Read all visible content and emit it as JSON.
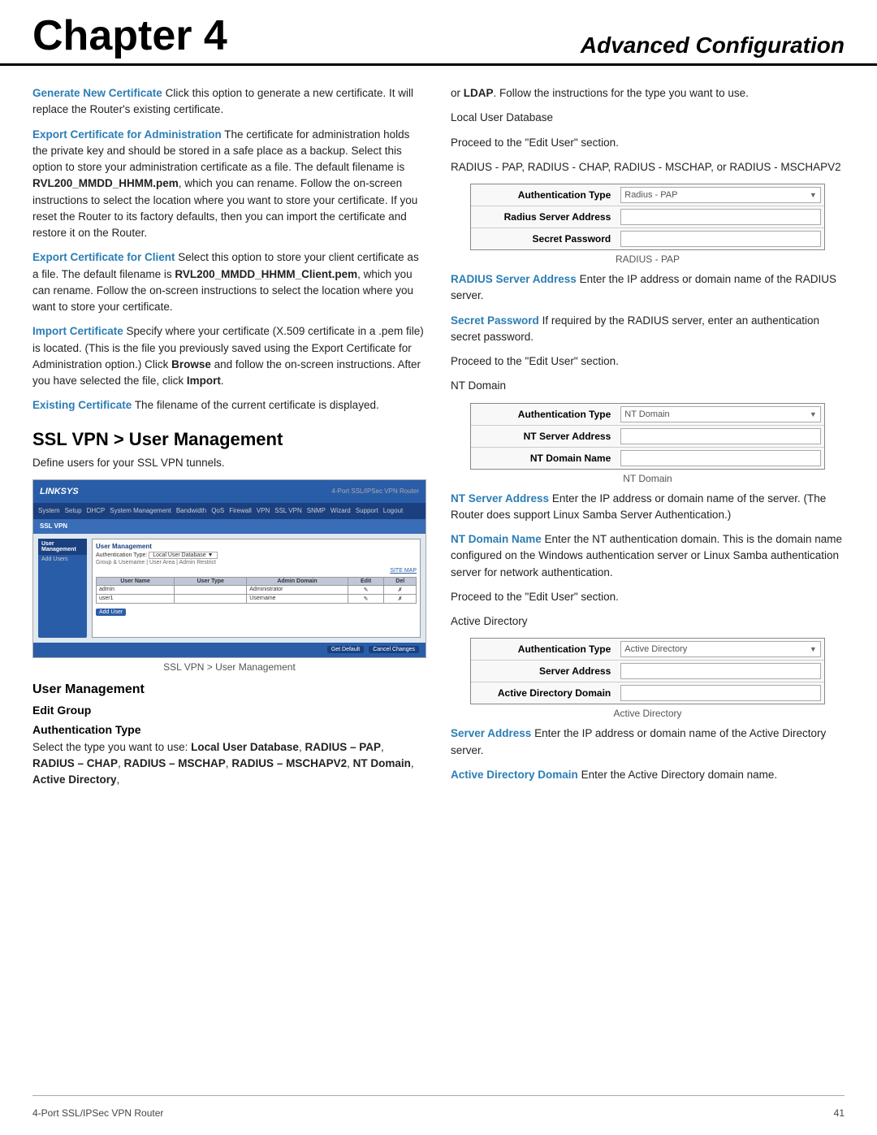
{
  "header": {
    "chapter": "Chapter 4",
    "title": "Advanced Configuration"
  },
  "footer": {
    "left": "4-Port SSL/IPSec VPN Router",
    "right": "41"
  },
  "left_col": {
    "paragraphs": [
      {
        "id": "generate-cert",
        "label": "Generate New Certificate",
        "text": " Click this option to generate a new certificate. It will replace the Router's existing certificate."
      },
      {
        "id": "export-cert-admin",
        "label": "Export Certificate for Administration",
        "text": " The certificate for administration holds the private key and should be stored in a safe place as a backup. Select this option to store your administration certificate as a file. The default filename is ",
        "bold_inline": "RVL200_MMDD_HHMM.pem",
        "text2": ", which you can rename. Follow the on-screen instructions to select the location where you want to store your certificate. If you reset the Router to its factory defaults, then you can import the certificate and restore it on the Router."
      },
      {
        "id": "export-cert-client",
        "label": "Export Certificate for Client",
        "text": " Select this option to store your client certificate as a file. The default filename is ",
        "bold_inline": "RVL200_MMDD_HHMM_Client.pem",
        "text2": ", which you can rename. Follow the on-screen instructions to select the location where you want to store your certificate."
      },
      {
        "id": "import-cert",
        "label": "Import Certificate",
        "text": " Specify where your certificate (X.509 certificate in a .pem file) is located. (This is the file you previously saved using the Export Certificate for Administration option.) Click ",
        "bold_inline2": "Browse",
        "text2": " and follow the on-screen instructions. After you have selected the file, click ",
        "bold_inline3": "Import",
        "text3": "."
      },
      {
        "id": "existing-cert",
        "label": "Existing Certificate",
        "text": " The filename of the current certificate is displayed."
      }
    ],
    "ssl_section": {
      "heading": "SSL VPN > User Management",
      "intro": "Define users for your SSL VPN tunnels.",
      "screenshot_caption": "SSL VPN > User Management"
    },
    "user_mgmt": {
      "heading": "User Management",
      "edit_group": "Edit Group",
      "auth_type_heading": "Authentication Type",
      "auth_type_text": "Select the type you want to use: ",
      "auth_type_options": "Local User Database, RADIUS – PAP, RADIUS – CHAP, RADIUS – MSCHAP, RADIUS – MSCHAPV2, NT Domain, Active Directory,"
    }
  },
  "right_col": {
    "ldap_text": "or ",
    "ldap_bold": "LDAP",
    "ldap_rest": ". Follow the instructions for the type you want to use.",
    "local_user_db": "Local User Database",
    "proceed_edit_user": "Proceed to the \"Edit User\" section.",
    "radius_options": "RADIUS - PAP, RADIUS - CHAP, RADIUS - MSCHAP, or RADIUS - MSCHAPV2",
    "radius_box": {
      "caption": "RADIUS - PAP",
      "rows": [
        {
          "label": "Authentication Type",
          "value": "Radius - PAP",
          "type": "select"
        },
        {
          "label": "Radius Server Address",
          "value": "",
          "type": "input"
        },
        {
          "label": "Secret Password",
          "value": "",
          "type": "input"
        }
      ]
    },
    "radius_server_address": {
      "label": "RADIUS Server Address",
      "text": " Enter the IP address or domain name of the RADIUS server."
    },
    "secret_password": {
      "label": "Secret Password",
      "text": " If required by the RADIUS server, enter an authentication secret password."
    },
    "proceed_edit_user2": "Proceed to the \"Edit User\" section.",
    "nt_domain_label": "NT Domain",
    "nt_domain_box": {
      "caption": "NT Domain",
      "rows": [
        {
          "label": "Authentication Type",
          "value": "NT Domain",
          "type": "select"
        },
        {
          "label": "NT Server Address",
          "value": "",
          "type": "input"
        },
        {
          "label": "NT Domain Name",
          "value": "",
          "type": "input"
        }
      ]
    },
    "nt_server_address": {
      "label": "NT Server Address",
      "text": " Enter the IP address or domain name of the server. (The Router does support Linux Samba Server Authentication.)"
    },
    "nt_domain_name": {
      "label": "NT Domain Name",
      "text": " Enter the NT authentication domain. This is the domain name configured on the Windows authentication server or Linux Samba authentication server for network authentication."
    },
    "proceed_edit_user3": "Proceed to the \"Edit User\" section.",
    "active_directory_label": "Active Directory",
    "active_directory_box": {
      "caption": "Active Directory",
      "rows": [
        {
          "label": "Authentication Type",
          "value": "Active Directory",
          "type": "select"
        },
        {
          "label": "Server Address",
          "value": "",
          "type": "input"
        },
        {
          "label": "Active Directory Domain",
          "value": "",
          "type": "input"
        }
      ]
    },
    "server_address": {
      "label": "Server Address",
      "text": " Enter the IP address or domain name of the Active Directory server."
    },
    "active_directory_domain": {
      "label": "Active Directory Domain",
      "text": " Enter the Active Directory domain name."
    }
  }
}
